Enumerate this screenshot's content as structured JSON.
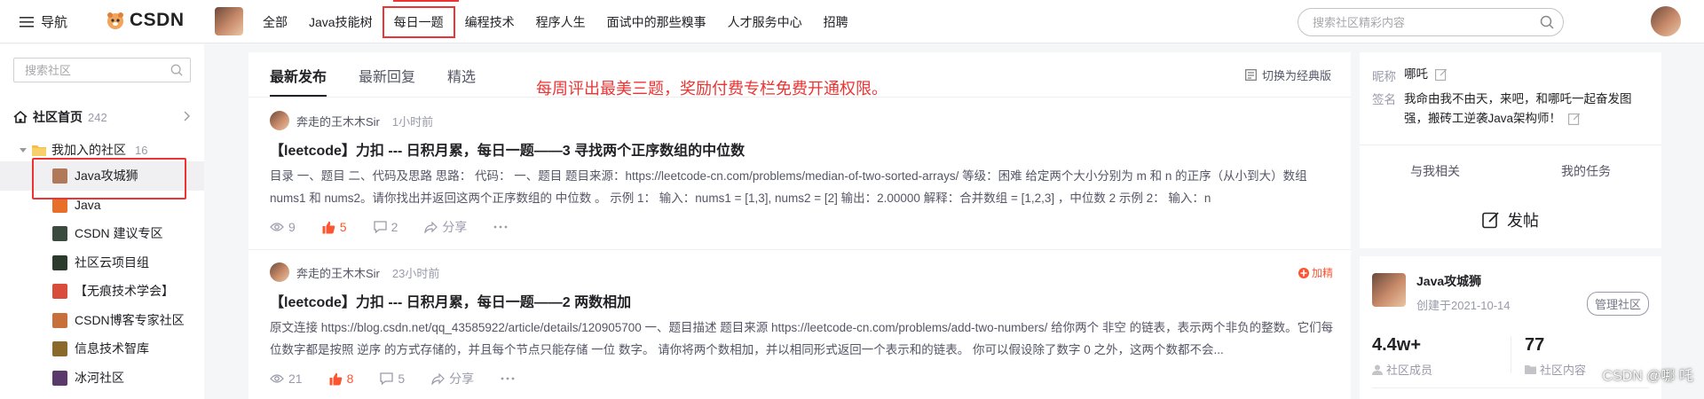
{
  "topbar": {
    "nav_label": "导航",
    "brand": "CSDN",
    "nav_items": [
      {
        "label": "全部",
        "active": false
      },
      {
        "label": "Java技能树",
        "active": false
      },
      {
        "label": "每日一题",
        "active": true
      },
      {
        "label": "编程技术",
        "active": false
      },
      {
        "label": "程序人生",
        "active": false
      },
      {
        "label": "面试中的那些糗事",
        "active": false
      },
      {
        "label": "人才服务中心",
        "active": false
      },
      {
        "label": "招聘",
        "active": false
      }
    ],
    "search_placeholder": "搜索社区精彩内容"
  },
  "sidebar": {
    "search_placeholder": "搜索社区",
    "home_label": "社区首页",
    "home_count": "242",
    "joined_label": "我加入的社区",
    "joined_count": "16",
    "communities": [
      {
        "label": "Java攻城狮",
        "active": true,
        "icon_color": "#b07a5a"
      },
      {
        "label": "Java",
        "active": false,
        "icon_color": "#e76f2a"
      },
      {
        "label": "CSDN 建议专区",
        "active": false,
        "icon_color": "#3b4a3f"
      },
      {
        "label": "社区云项目组",
        "active": false,
        "icon_color": "#2c3a2e"
      },
      {
        "label": "【无痕技术学会】",
        "active": false,
        "icon_color": "#d94b3b"
      },
      {
        "label": "CSDN博客专家社区",
        "active": false,
        "icon_color": "#c8703a"
      },
      {
        "label": "信息技术智库",
        "active": false,
        "icon_color": "#8a6a2a"
      },
      {
        "label": "冰河社区",
        "active": false,
        "icon_color": "#5a3a6a"
      }
    ]
  },
  "feed": {
    "tabs": [
      {
        "label": "最新发布",
        "active": true
      },
      {
        "label": "最新回复",
        "active": false
      },
      {
        "label": "精选",
        "active": false
      }
    ],
    "promo": "每周评出最美三题，奖励付费专栏免费开通权限。",
    "switch_label": "切换为经典版",
    "posts": [
      {
        "author": "奔走的王木木Sir",
        "time": "1小时前",
        "title": "【leetcode】力扣 --- 日积月累，每日一题——3 寻找两个正序数组的中位数",
        "excerpt": "目录 一、题目 二、代码及思路 思路： 代码： 一、题目 题目来源：https://leetcode-cn.com/problems/median-of-two-sorted-arrays/ 等级：困难 给定两个大小分别为 m 和 n 的正序（从小到大）数组 nums1 和 nums2。请你找出并返回这两个正序数组的 中位数 。 示例 1： 输入：nums1 = [1,3], nums2 = [2] 输出：2.00000 解释：合并数组 = [1,2,3] ，中位数 2 示例 2： 输入：n",
        "views": "9",
        "likes": "5",
        "comments": "2",
        "share": "分享",
        "badge": ""
      },
      {
        "author": "奔走的王木木Sir",
        "time": "23小时前",
        "title": "【leetcode】力扣 --- 日积月累，每日一题——2 两数相加",
        "excerpt": "原文连接 https://blog.csdn.net/qq_43585922/article/details/120905700 一、题目描述 题目来源 https://leetcode-cn.com/problems/add-two-numbers/ 给你两个 非空 的链表，表示两个非负的整数。它们每位数字都是按照 逆序 的方式存储的，并且每个节点只能存储 一位 数字。 请你将两个数相加，并以相同形式返回一个表示和的链表。 你可以假设除了数字 0 之外，这两个数都不会...",
        "views": "21",
        "likes": "8",
        "comments": "5",
        "share": "分享",
        "badge": "加精"
      }
    ]
  },
  "profile": {
    "nick_key": "昵称",
    "nick": "哪吒",
    "sign_key": "签名",
    "sign": "我命由我不由天，来吧，和哪吒一起奋发图强，搬砖工逆袭Java架构师！",
    "tabs": [
      "与我相关",
      "我的任务"
    ]
  },
  "post_button": "发帖",
  "community": {
    "name": "Java攻城狮",
    "created": "创建于2021-10-14",
    "manage": "管理社区",
    "members_num": "4.4w+",
    "members_label": "社区成员",
    "content_num": "77",
    "content_label": "社区内容"
  },
  "watermark": "CSDN @哪 吒",
  "colors": {
    "accent": "#fc5531",
    "highlight": "#ee3333"
  }
}
